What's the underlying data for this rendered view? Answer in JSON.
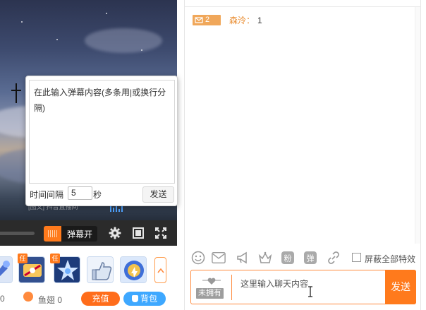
{
  "video": {
    "caption": "[图文] 抖音直播间",
    "danmu_popup": {
      "placeholder": "在此输入弹幕内容(多条用|或换行分隔)",
      "interval_label": "时间间隔",
      "interval_value": "5",
      "interval_unit": "秒",
      "send_label": "发送"
    },
    "player_bar": {
      "danmu_toggle_label": "弹幕开",
      "icons": [
        "gear-icon",
        "fullscreen-window-icon",
        "fullscreen-expand-icon"
      ]
    }
  },
  "gifts": {
    "items": [
      {
        "name": "gift-1",
        "tag": ""
      },
      {
        "name": "gift-2",
        "tag": "任"
      },
      {
        "name": "gift-3",
        "tag": "任"
      },
      {
        "name": "gift-4-thumbs-up",
        "tag": ""
      },
      {
        "name": "gift-5",
        "tag": ""
      }
    ],
    "more_icon": "chevron-up-icon"
  },
  "wallet": {
    "count": "0",
    "fish_label": "鱼翅 0",
    "recharge_label": "充值",
    "bag_label": "背包"
  },
  "chat": {
    "messages": [
      {
        "level": "2",
        "user": "森泠：",
        "text": "1"
      }
    ],
    "toolbar": {
      "icons": [
        "emoji-icon",
        "mail-icon",
        "megaphone-icon",
        "crown-icon",
        "fan-badge-icon",
        "danmu-badge-icon",
        "link-icon"
      ],
      "shield_label": "屏蔽全部特效"
    },
    "input": {
      "unowned_label": "未拥有",
      "placeholder": "这里输入聊天内容",
      "send_label": "发送"
    }
  },
  "colors": {
    "accent": "#ff7a1c",
    "blue": "#3ea8ff",
    "user_name": "#e98b2e"
  }
}
